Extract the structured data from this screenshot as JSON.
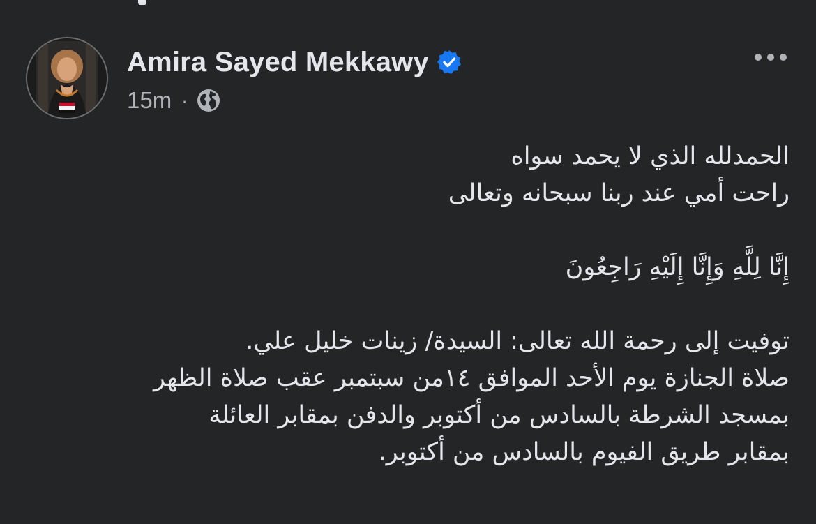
{
  "post": {
    "author": {
      "name": "Amira Sayed Mekkawy",
      "verified": true,
      "verified_color": "#1877f2",
      "avatar_icon": "profile-photo"
    },
    "time": "15m",
    "separator": "·",
    "audience_icon": "globe-icon",
    "more_icon": "more-options-icon",
    "paragraphs": [
      {
        "lines": [
          "الحمدلله الذي لا يحمد سواه",
          "راحت أمي عند  ربنا سبحانه وتعالى"
        ]
      },
      {
        "lines": [
          "إِنَّا لِلَّهِ وَإِنَّا إِلَيْهِ رَاجِعُونَ"
        ]
      },
      {
        "lines": [
          "توفيت إلى رحمة الله تعالى: السيدة/ زينات خليل علي.",
          "صلاة الجنازة يوم الأحد الموافق ١٤من سبتمبر عقب صلاة الظهر",
          "بمسجد الشرطة بالسادس من أكتوبر والدفن بمقابر العائلة",
          "بمقابر طريق الفيوم بالسادس من أكتوبر."
        ]
      }
    ]
  },
  "theme": {
    "background": "#242526",
    "text_primary": "#e4e6eb",
    "text_secondary": "#b0b3b8"
  }
}
